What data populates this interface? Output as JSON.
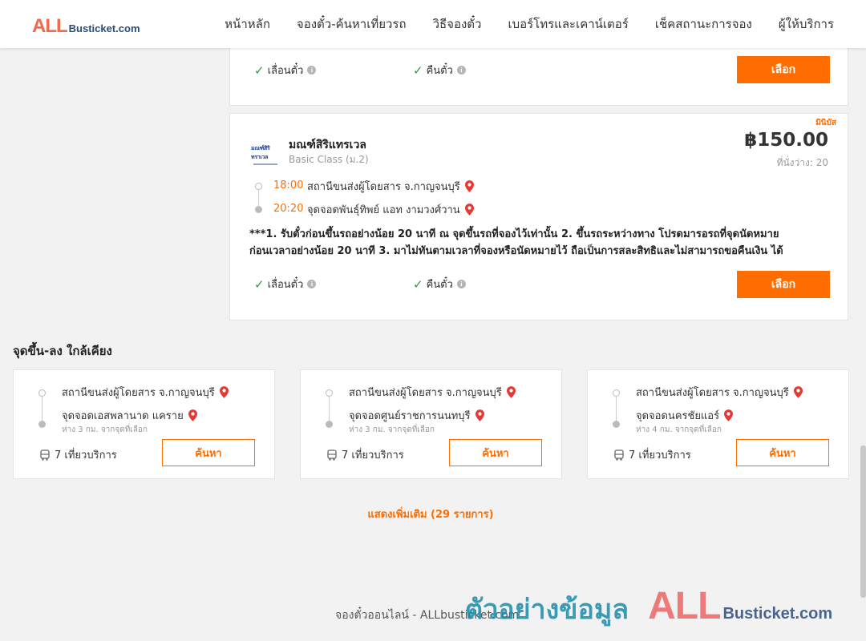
{
  "header": {
    "logo_all": "ALL",
    "logo_rest": "Busticket.com",
    "nav": [
      "หน้าหลัก",
      "จองตั๋ว-ค้นหาเที่ยวรถ",
      "วิธีจองตั๋ว",
      "เบอร์โทรและเคาน์เตอร์",
      "เช็คสถานะการจอง",
      "ผู้ให้บริการ"
    ]
  },
  "top_card": {
    "feature_change": "เลื่อนตั๋ว",
    "feature_refund": "คืนตั๋ว",
    "select_label": "เลือก"
  },
  "trip": {
    "badge": "มินิบัส",
    "operator_logo_text": "มณฑ์สิริ ทราเวล",
    "operator": "มณฑ์สิริแทรเวล",
    "class": "Basic Class (ม.2)",
    "price": "฿150.00",
    "seats": "ที่นั่งว่าง: 20",
    "depart_time": "18:00",
    "depart_stop": "สถานีขนส่งผู้โดยสาร จ.กาญจนบุรี",
    "arrive_time": "20:20",
    "arrive_stop": "จุดจอดพันธุ์ทิพย์ แอท งามวงศ์วาน",
    "note_line1": "***1. รับตั๋วก่อนขึ้นรถอย่างน้อย 20 นาที ณ จุดขึ้นรถที่จองไว้เท่านั้น 2. ขึ้นรถระหว่างทาง โปรดมารอรถที่จุดนัดหมาย",
    "note_line2": "ก่อนเวลาอย่างน้อย 20 นาที 3. มาไม่ทันตามเวลาที่จองหรือนัดหมายไว้ ถือเป็นการสละสิทธิและไม่สามารถขอคืนเงิน ได้",
    "feature_change": "เลื่อนตั๋ว",
    "feature_refund": "คืนตั๋ว",
    "select_label": "เลือก"
  },
  "nearby": {
    "title": "จุดขึ้น-ลง ใกล้เคียง",
    "cards": [
      {
        "from": "สถานีขนส่งผู้โดยสาร จ.กาญจนบุรี",
        "to": "จุดจอดเอสพลานาด แคราย",
        "distance": "ห่าง 3 กม. จากจุดที่เลือก",
        "trips": "7 เที่ยวบริการ",
        "button": "ค้นหา"
      },
      {
        "from": "สถานีขนส่งผู้โดยสาร จ.กาญจนบุรี",
        "to": "จุดจอดศูนย์ราชการนนทบุรี",
        "distance": "ห่าง 3 กม. จากจุดที่เลือก",
        "trips": "7 เที่ยวบริการ",
        "button": "ค้นหา"
      },
      {
        "from": "สถานีขนส่งผู้โดยสาร จ.กาญจนบุรี",
        "to": "จุดจอดนครชัยแอร์",
        "distance": "ห่าง 4 กม. จากจุดที่เลือก",
        "trips": "7 เที่ยวบริการ",
        "button": "ค้นหา"
      }
    ],
    "show_more": "แสดงเพิ่มเติม (29 รายการ)"
  },
  "footer": {
    "text": "จองตั๋วออนไลน์ - ALLbusticket.com"
  },
  "watermark": {
    "text": "ตัวอย่างข้อมูล",
    "logo_all": "ALL",
    "logo_rest": "Busticket.com"
  },
  "colors": {
    "accent": "#ff6d00",
    "check": "#2e9c3e",
    "pin": "#e53935"
  }
}
